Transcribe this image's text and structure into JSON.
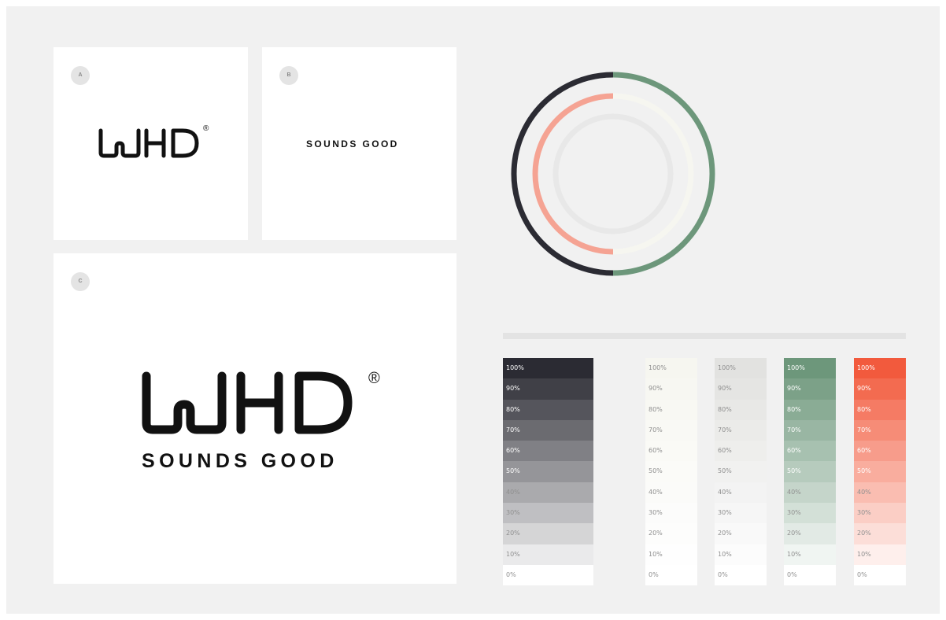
{
  "cards": {
    "a": {
      "badge": "A",
      "logo": "WHD",
      "mark": "®"
    },
    "b": {
      "badge": "B",
      "tagline": "SOUNDS GOOD"
    },
    "c": {
      "badge": "C",
      "logo": "WHD",
      "mark": "®",
      "tagline": "SOUNDS GOOD"
    }
  },
  "ring_colors": {
    "dark": "#2b2b33",
    "green": "#6d977b",
    "coral": "#f5a393",
    "light": "#e8e8e8",
    "cream": "#f6f6f0"
  },
  "palette": {
    "columns": [
      {
        "name": "dark",
        "color": "#2b2b33",
        "light_text_from": 50,
        "steps": [
          "100%",
          "90%",
          "80%",
          "70%",
          "60%",
          "50%",
          "40%",
          "30%",
          "20%",
          "10%",
          "0%"
        ]
      },
      {
        "name": "cream",
        "color": "#f6f6f0",
        "light_text_from": 101,
        "steps": [
          "100%",
          "90%",
          "80%",
          "70%",
          "60%",
          "50%",
          "40%",
          "30%",
          "20%",
          "10%",
          "0%"
        ]
      },
      {
        "name": "gray",
        "color": "#e2e2e0",
        "light_text_from": 101,
        "steps": [
          "100%",
          "90%",
          "80%",
          "70%",
          "60%",
          "50%",
          "40%",
          "30%",
          "20%",
          "10%",
          "0%"
        ]
      },
      {
        "name": "green",
        "color": "#6d977b",
        "light_text_from": 50,
        "steps": [
          "100%",
          "90%",
          "80%",
          "70%",
          "60%",
          "50%",
          "40%",
          "30%",
          "20%",
          "10%",
          "0%"
        ]
      },
      {
        "name": "coral",
        "color": "#f25a3d",
        "light_text_from": 50,
        "steps": [
          "100%",
          "90%",
          "80%",
          "70%",
          "60%",
          "50%",
          "40%",
          "30%",
          "20%",
          "10%",
          "0%"
        ]
      }
    ]
  }
}
